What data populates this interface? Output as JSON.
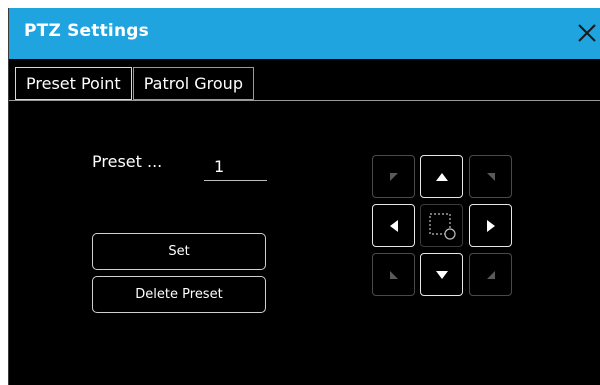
{
  "dialog": {
    "title": "PTZ Settings",
    "close_icon": "close-icon",
    "accent_color": "#1fa4e0"
  },
  "tabs": [
    {
      "label": "Preset Point",
      "active": true
    },
    {
      "label": "Patrol Group",
      "active": false
    }
  ],
  "preset": {
    "label": "Preset ...",
    "value": "1"
  },
  "buttons": {
    "set": "Set",
    "delete": "Delete Preset"
  },
  "ptz_pad": {
    "up": "arrow-up-icon",
    "down": "arrow-down-icon",
    "left": "arrow-left-icon",
    "right": "arrow-right-icon",
    "up_left": "arrow-up-left-icon",
    "up_right": "arrow-up-right-icon",
    "down_left": "arrow-down-left-icon",
    "down_right": "arrow-down-right-icon",
    "center": "zoom-select-icon",
    "diagonals_enabled": false
  }
}
